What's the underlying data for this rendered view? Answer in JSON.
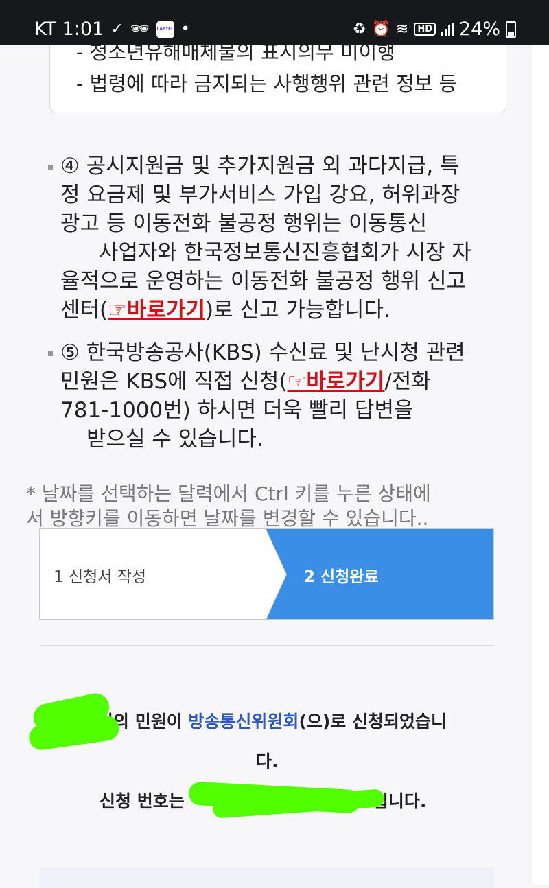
{
  "status_bar": {
    "carrier_time": "KT 1:01",
    "laftel_label": "LAFTEL",
    "hd_label": "HD",
    "battery": "24%"
  },
  "top_box": {
    "line1": "- 청소년유해매체물의 표시의무 미이행",
    "line2": "- 법령에 따라 금지되는 사행행위 관련 정보 등"
  },
  "notice4": {
    "line1": "④ 공시지원금 및 추가지원금 외 과다지급, 특",
    "line2": "정 요금제 및 부가서비스 가입 강요, 허위과장",
    "line3": "광고 등 이동전화 불공정 행위는 이동통신",
    "line4": "사업자와 한국정보통신진흥협회가 시장 자",
    "line5": "율적으로 운영하는 이동전화 불공정 행위 신고",
    "line6_prefix": "센터(",
    "link": "☞바로가기",
    "line6_suffix": ")로 신고 가능합니다."
  },
  "notice5": {
    "line1": "⑤ 한국방송공사(KBS) 수신료 및 난시청 관련",
    "line2_prefix": "민원은 KBS에 직접 신청(",
    "link": "☞바로가기",
    "line2_suffix": "/전화",
    "line3": "781-1000번) 하시면 더욱 빨리 답변을",
    "line4": "받으실 수 있습니다."
  },
  "hint": {
    "line1": "* 날짜를 선택하는 달력에서 Ctrl 키를 누른 상태에",
    "line2": "서 방향키를 이동하면 날짜를 변경할 수 있습니다.."
  },
  "steps": {
    "step1": "1 신청서 작성",
    "step2": "2 신청완료"
  },
  "result": {
    "line1_prefix": "님의 민원이 ",
    "agency": "방송통신위원회",
    "line1_suffix": "(으)로 신청되었습니",
    "line2": "다.",
    "line3_prefix": "신청 번호는",
    "line3_suffix": "1 입니다."
  },
  "colors": {
    "status_bar_bg": "#16181b",
    "step_active": "#3a8ee6",
    "link_red": "#d70f15",
    "agency_blue": "#2d57c5",
    "redaction": "#52ff00"
  }
}
